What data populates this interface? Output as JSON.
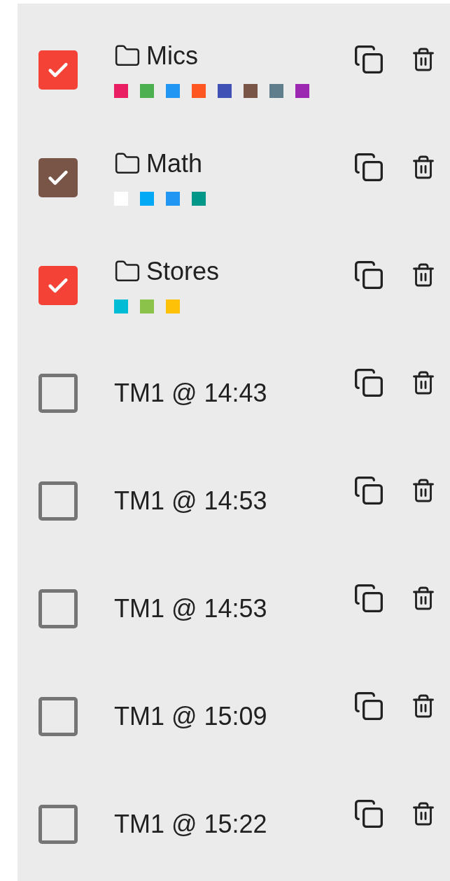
{
  "rows": [
    {
      "kind": "folder",
      "name": "Mics",
      "checked": true,
      "color": "#f44336",
      "swatches": [
        {
          "color": "#e91e63"
        },
        {
          "color": "#4caf50"
        },
        {
          "color": "#2196f3"
        },
        {
          "color": "#ff5722"
        },
        {
          "color": "#3f51b5"
        },
        {
          "color": "#795548"
        },
        {
          "color": "#607d8b"
        },
        {
          "color": "#9c27b0"
        }
      ]
    },
    {
      "kind": "folder",
      "name": "Math",
      "checked": true,
      "color": "#795548",
      "swatches": [
        {
          "color": "#ffffff"
        },
        {
          "color": "#03a9f4"
        },
        {
          "color": "#2196f3"
        },
        {
          "color": "#009688"
        }
      ]
    },
    {
      "kind": "folder",
      "name": "Stores",
      "checked": true,
      "color": "#f44336",
      "swatches": [
        {
          "color": "#00bcd4"
        },
        {
          "color": "#8bc34a"
        },
        {
          "color": "#ffc107"
        }
      ]
    },
    {
      "kind": "item",
      "name": "TM1 @ 14:43",
      "checked": false
    },
    {
      "kind": "item",
      "name": "TM1 @ 14:53",
      "checked": false
    },
    {
      "kind": "item",
      "name": "TM1 @ 14:53",
      "checked": false
    },
    {
      "kind": "item",
      "name": "TM1 @ 15:09",
      "checked": false
    },
    {
      "kind": "item",
      "name": "TM1 @ 15:22",
      "checked": false
    }
  ]
}
